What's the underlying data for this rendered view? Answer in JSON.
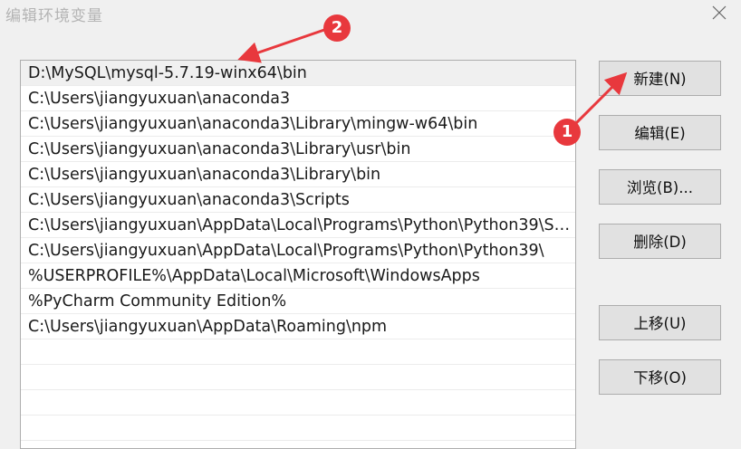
{
  "window": {
    "title": "编辑环境变量"
  },
  "path_list": {
    "items": [
      "D:\\MySQL\\mysql-5.7.19-winx64\\bin",
      "C:\\Users\\jiangyuxuan\\anaconda3",
      "C:\\Users\\jiangyuxuan\\anaconda3\\Library\\mingw-w64\\bin",
      "C:\\Users\\jiangyuxuan\\anaconda3\\Library\\usr\\bin",
      "C:\\Users\\jiangyuxuan\\anaconda3\\Library\\bin",
      "C:\\Users\\jiangyuxuan\\anaconda3\\Scripts",
      "C:\\Users\\jiangyuxuan\\AppData\\Local\\Programs\\Python\\Python39\\Sc...",
      "C:\\Users\\jiangyuxuan\\AppData\\Local\\Programs\\Python\\Python39\\",
      "%USERPROFILE%\\AppData\\Local\\Microsoft\\WindowsApps",
      "%PyCharm Community Edition%",
      "C:\\Users\\jiangyuxuan\\AppData\\Roaming\\npm",
      "",
      "",
      "",
      ""
    ],
    "selected_index": 0
  },
  "buttons": {
    "new": "新建(N)",
    "edit": "编辑(E)",
    "browse": "浏览(B)...",
    "delete": "删除(D)",
    "move_up": "上移(U)",
    "move_down": "下移(O)"
  },
  "annotations": {
    "marker_1": "1",
    "marker_2": "2",
    "color": "#e8383d"
  }
}
